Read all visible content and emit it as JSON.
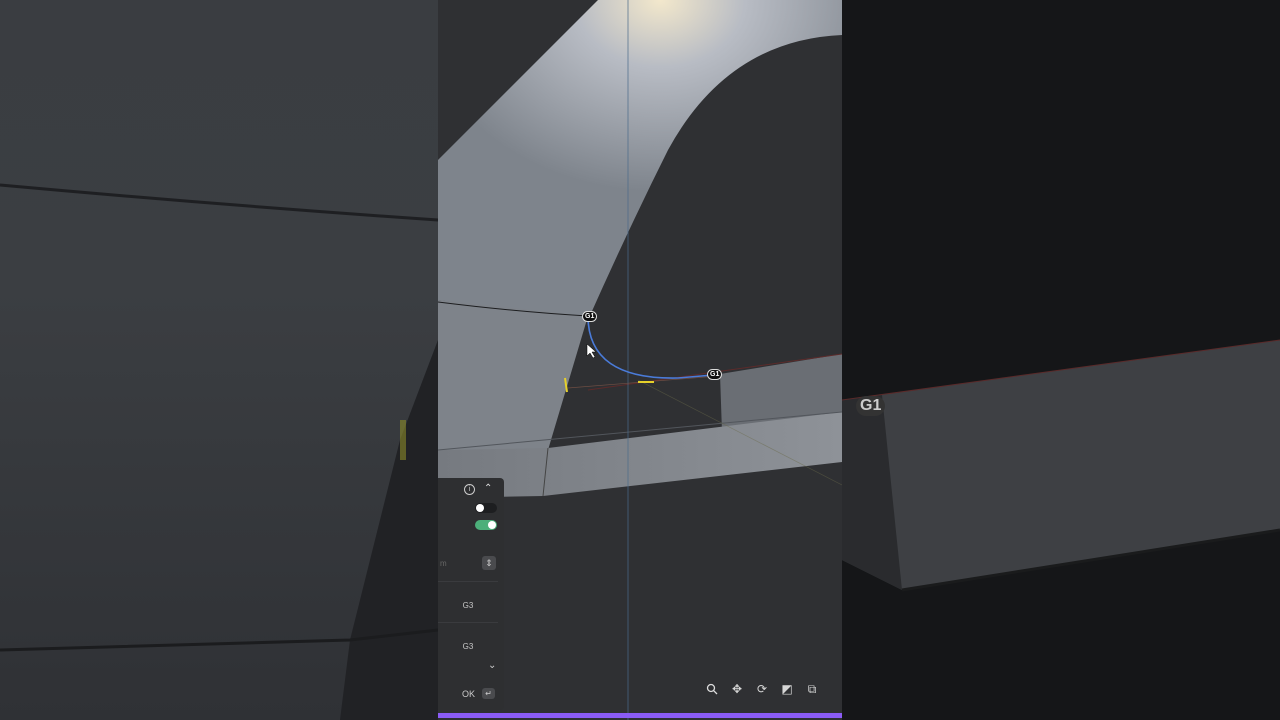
{
  "viewport": {
    "tags": [
      {
        "label": "G1"
      },
      {
        "label": "G1"
      }
    ],
    "overlay_tag": {
      "label": "G1"
    }
  },
  "panel": {
    "info_icon": "info-icon",
    "collapse_icon": "chevron-up-icon",
    "toggle1": {
      "on": false
    },
    "toggle2": {
      "on": true,
      "color": "#4caf7a"
    },
    "input_placeholder": "m",
    "stepper_icon": "stepper-icon",
    "continuity1": "G3",
    "continuity2": "G3",
    "expand_icon": "chevron-down-icon",
    "ok_label": "OK",
    "enter_icon": "enter-icon"
  },
  "toolbar": {
    "tools": [
      "search-icon",
      "move-icon",
      "rotate-icon",
      "scale-icon",
      "copy-icon"
    ]
  },
  "colors": {
    "accent": "#8b5cf6",
    "curve": "#4a7bd9",
    "toggle_on": "#4caf7a"
  }
}
